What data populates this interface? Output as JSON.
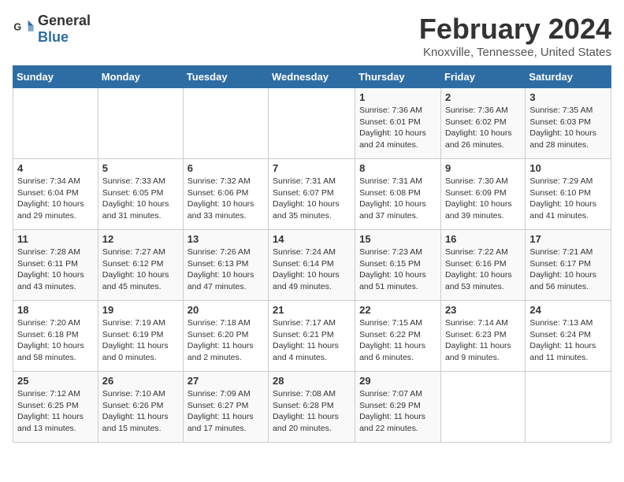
{
  "header": {
    "logo_general": "General",
    "logo_blue": "Blue",
    "title": "February 2024",
    "subtitle": "Knoxville, Tennessee, United States"
  },
  "calendar": {
    "days_of_week": [
      "Sunday",
      "Monday",
      "Tuesday",
      "Wednesday",
      "Thursday",
      "Friday",
      "Saturday"
    ],
    "weeks": [
      [
        {
          "day": "",
          "sunrise": "",
          "sunset": "",
          "daylight": ""
        },
        {
          "day": "",
          "sunrise": "",
          "sunset": "",
          "daylight": ""
        },
        {
          "day": "",
          "sunrise": "",
          "sunset": "",
          "daylight": ""
        },
        {
          "day": "",
          "sunrise": "",
          "sunset": "",
          "daylight": ""
        },
        {
          "day": "1",
          "sunrise": "Sunrise: 7:36 AM",
          "sunset": "Sunset: 6:01 PM",
          "daylight": "Daylight: 10 hours and 24 minutes."
        },
        {
          "day": "2",
          "sunrise": "Sunrise: 7:36 AM",
          "sunset": "Sunset: 6:02 PM",
          "daylight": "Daylight: 10 hours and 26 minutes."
        },
        {
          "day": "3",
          "sunrise": "Sunrise: 7:35 AM",
          "sunset": "Sunset: 6:03 PM",
          "daylight": "Daylight: 10 hours and 28 minutes."
        }
      ],
      [
        {
          "day": "4",
          "sunrise": "Sunrise: 7:34 AM",
          "sunset": "Sunset: 6:04 PM",
          "daylight": "Daylight: 10 hours and 29 minutes."
        },
        {
          "day": "5",
          "sunrise": "Sunrise: 7:33 AM",
          "sunset": "Sunset: 6:05 PM",
          "daylight": "Daylight: 10 hours and 31 minutes."
        },
        {
          "day": "6",
          "sunrise": "Sunrise: 7:32 AM",
          "sunset": "Sunset: 6:06 PM",
          "daylight": "Daylight: 10 hours and 33 minutes."
        },
        {
          "day": "7",
          "sunrise": "Sunrise: 7:31 AM",
          "sunset": "Sunset: 6:07 PM",
          "daylight": "Daylight: 10 hours and 35 minutes."
        },
        {
          "day": "8",
          "sunrise": "Sunrise: 7:31 AM",
          "sunset": "Sunset: 6:08 PM",
          "daylight": "Daylight: 10 hours and 37 minutes."
        },
        {
          "day": "9",
          "sunrise": "Sunrise: 7:30 AM",
          "sunset": "Sunset: 6:09 PM",
          "daylight": "Daylight: 10 hours and 39 minutes."
        },
        {
          "day": "10",
          "sunrise": "Sunrise: 7:29 AM",
          "sunset": "Sunset: 6:10 PM",
          "daylight": "Daylight: 10 hours and 41 minutes."
        }
      ],
      [
        {
          "day": "11",
          "sunrise": "Sunrise: 7:28 AM",
          "sunset": "Sunset: 6:11 PM",
          "daylight": "Daylight: 10 hours and 43 minutes."
        },
        {
          "day": "12",
          "sunrise": "Sunrise: 7:27 AM",
          "sunset": "Sunset: 6:12 PM",
          "daylight": "Daylight: 10 hours and 45 minutes."
        },
        {
          "day": "13",
          "sunrise": "Sunrise: 7:26 AM",
          "sunset": "Sunset: 6:13 PM",
          "daylight": "Daylight: 10 hours and 47 minutes."
        },
        {
          "day": "14",
          "sunrise": "Sunrise: 7:24 AM",
          "sunset": "Sunset: 6:14 PM",
          "daylight": "Daylight: 10 hours and 49 minutes."
        },
        {
          "day": "15",
          "sunrise": "Sunrise: 7:23 AM",
          "sunset": "Sunset: 6:15 PM",
          "daylight": "Daylight: 10 hours and 51 minutes."
        },
        {
          "day": "16",
          "sunrise": "Sunrise: 7:22 AM",
          "sunset": "Sunset: 6:16 PM",
          "daylight": "Daylight: 10 hours and 53 minutes."
        },
        {
          "day": "17",
          "sunrise": "Sunrise: 7:21 AM",
          "sunset": "Sunset: 6:17 PM",
          "daylight": "Daylight: 10 hours and 56 minutes."
        }
      ],
      [
        {
          "day": "18",
          "sunrise": "Sunrise: 7:20 AM",
          "sunset": "Sunset: 6:18 PM",
          "daylight": "Daylight: 10 hours and 58 minutes."
        },
        {
          "day": "19",
          "sunrise": "Sunrise: 7:19 AM",
          "sunset": "Sunset: 6:19 PM",
          "daylight": "Daylight: 11 hours and 0 minutes."
        },
        {
          "day": "20",
          "sunrise": "Sunrise: 7:18 AM",
          "sunset": "Sunset: 6:20 PM",
          "daylight": "Daylight: 11 hours and 2 minutes."
        },
        {
          "day": "21",
          "sunrise": "Sunrise: 7:17 AM",
          "sunset": "Sunset: 6:21 PM",
          "daylight": "Daylight: 11 hours and 4 minutes."
        },
        {
          "day": "22",
          "sunrise": "Sunrise: 7:15 AM",
          "sunset": "Sunset: 6:22 PM",
          "daylight": "Daylight: 11 hours and 6 minutes."
        },
        {
          "day": "23",
          "sunrise": "Sunrise: 7:14 AM",
          "sunset": "Sunset: 6:23 PM",
          "daylight": "Daylight: 11 hours and 9 minutes."
        },
        {
          "day": "24",
          "sunrise": "Sunrise: 7:13 AM",
          "sunset": "Sunset: 6:24 PM",
          "daylight": "Daylight: 11 hours and 11 minutes."
        }
      ],
      [
        {
          "day": "25",
          "sunrise": "Sunrise: 7:12 AM",
          "sunset": "Sunset: 6:25 PM",
          "daylight": "Daylight: 11 hours and 13 minutes."
        },
        {
          "day": "26",
          "sunrise": "Sunrise: 7:10 AM",
          "sunset": "Sunset: 6:26 PM",
          "daylight": "Daylight: 11 hours and 15 minutes."
        },
        {
          "day": "27",
          "sunrise": "Sunrise: 7:09 AM",
          "sunset": "Sunset: 6:27 PM",
          "daylight": "Daylight: 11 hours and 17 minutes."
        },
        {
          "day": "28",
          "sunrise": "Sunrise: 7:08 AM",
          "sunset": "Sunset: 6:28 PM",
          "daylight": "Daylight: 11 hours and 20 minutes."
        },
        {
          "day": "29",
          "sunrise": "Sunrise: 7:07 AM",
          "sunset": "Sunset: 6:29 PM",
          "daylight": "Daylight: 11 hours and 22 minutes."
        },
        {
          "day": "",
          "sunrise": "",
          "sunset": "",
          "daylight": ""
        },
        {
          "day": "",
          "sunrise": "",
          "sunset": "",
          "daylight": ""
        }
      ]
    ]
  }
}
